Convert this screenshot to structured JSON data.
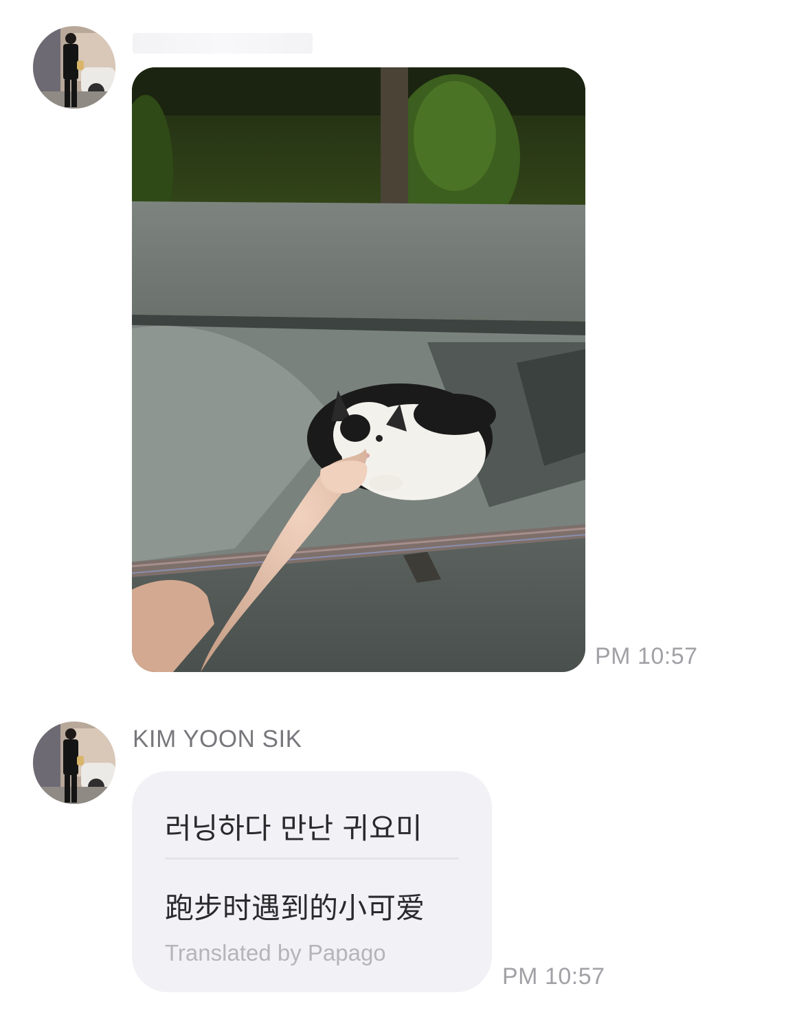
{
  "messages": [
    {
      "sender_name": "",
      "type": "image",
      "image_alt": "",
      "time": "PM 10:57"
    },
    {
      "sender_name": "KIM YOON SIK",
      "type": "text",
      "original_text": "러닝하다 만난 귀요미",
      "translated_text": "跑步时遇到的小可爱",
      "translation_credit": "Translated by Papago",
      "time": "PM 10:57"
    }
  ],
  "colors": {
    "background": "#ffffff",
    "bubble": "#f2f2f6",
    "timestamp": "#a1a1a6",
    "sender_name": "#77777c",
    "credit": "#b4b4b9"
  },
  "icons": [
    "avatar"
  ]
}
